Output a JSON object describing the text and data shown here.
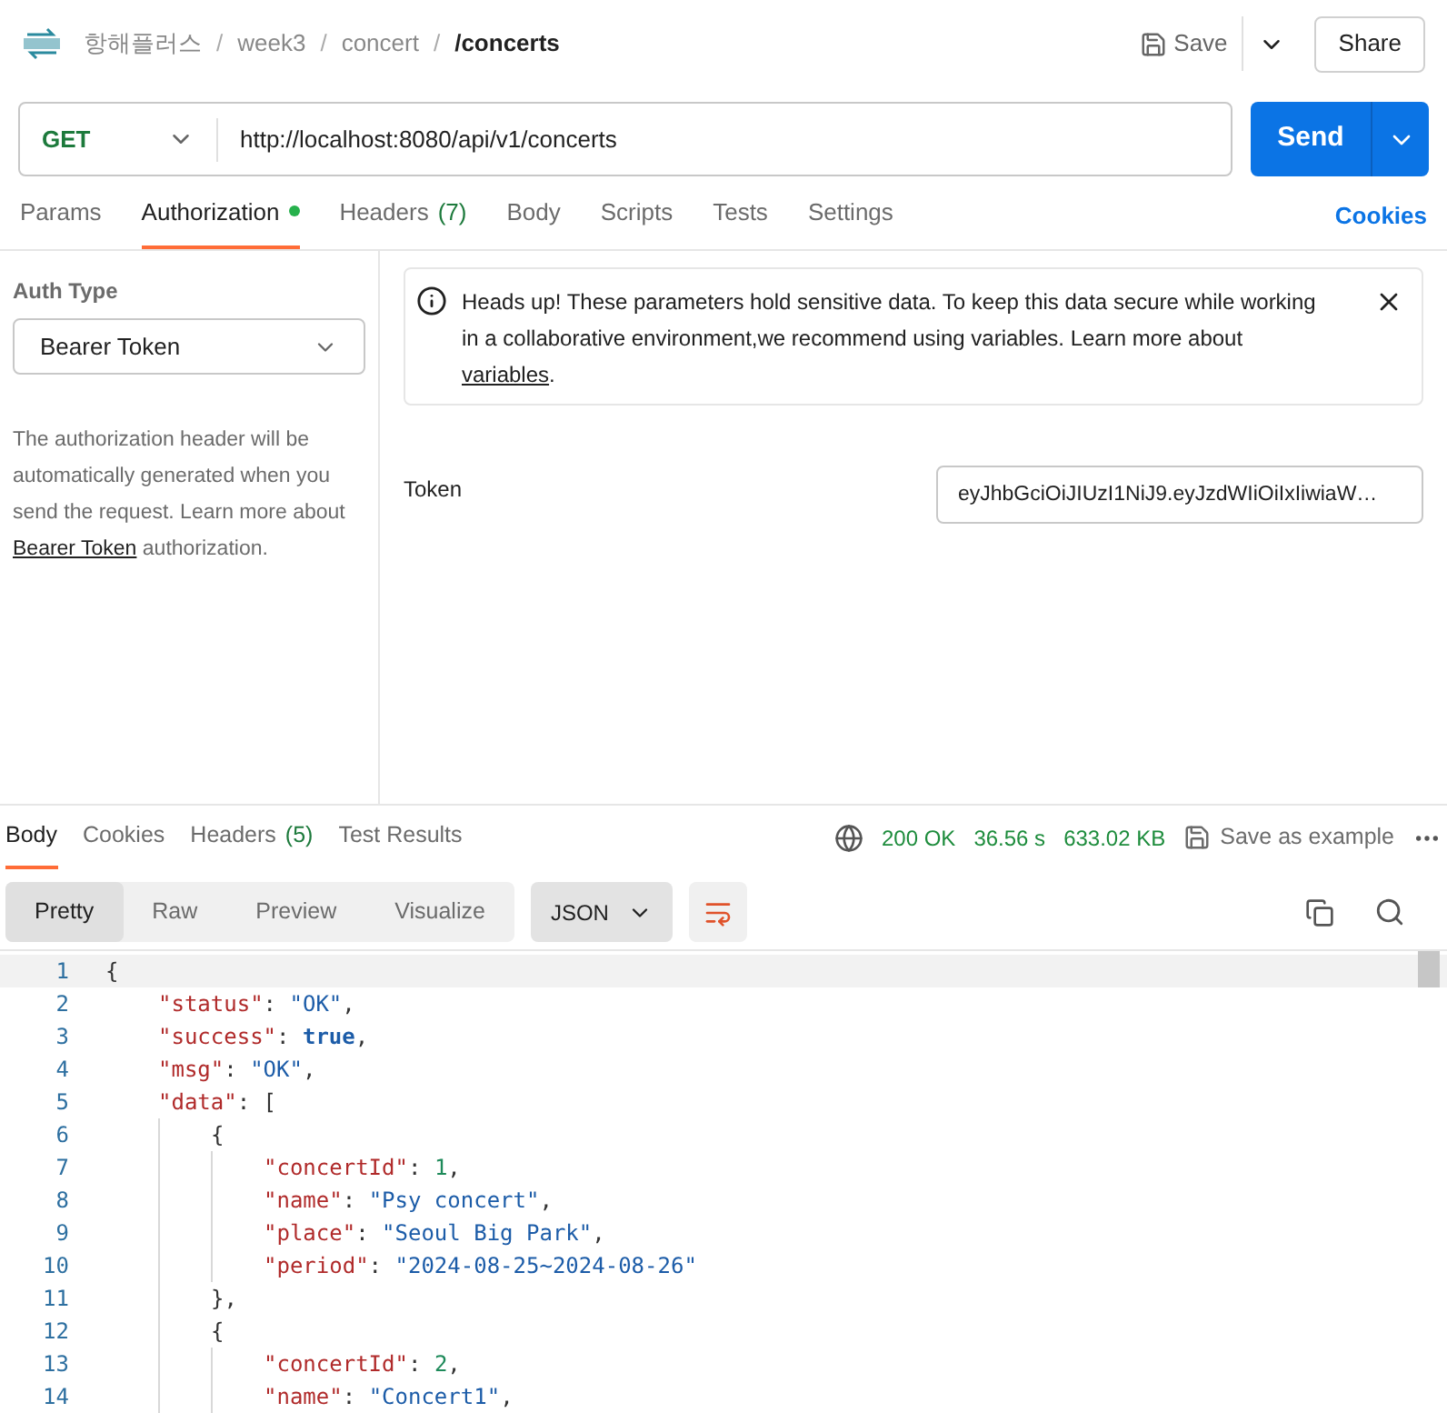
{
  "breadcrumb": [
    {
      "kind": "crumb",
      "text": "항해플러스"
    },
    {
      "kind": "separator",
      "text": "/"
    },
    {
      "kind": "crumb",
      "text": "week3"
    },
    {
      "kind": "separator",
      "text": "/"
    },
    {
      "kind": "crumb",
      "text": "concert"
    },
    {
      "kind": "separator",
      "text": "/"
    },
    {
      "kind": "current",
      "text": "/concerts"
    }
  ],
  "header_actions": {
    "save": "Save",
    "share": "Share"
  },
  "request": {
    "method": "GET",
    "url": "http://localhost:8080/api/v1/concerts",
    "send": "Send"
  },
  "request_tabs": [
    {
      "label": "Params",
      "selected": false
    },
    {
      "label": "Authorization",
      "selected": true,
      "dot": true
    },
    {
      "label": "Headers",
      "count": "(7)",
      "selected": false
    },
    {
      "label": "Body",
      "selected": false
    },
    {
      "label": "Scripts",
      "selected": false
    },
    {
      "label": "Tests",
      "selected": false
    },
    {
      "label": "Settings",
      "selected": false
    }
  ],
  "cookies_link": "Cookies",
  "auth": {
    "type_label": "Auth Type",
    "type": "Bearer Token",
    "description": "The authorization header will be automatically generated when you send the request. Learn more about ",
    "description_link": "Bearer Token",
    "description_end": " authorization.",
    "notice": "Heads up! These parameters hold sensitive data. To keep this data secure while working in a collaborative environment,we recommend using variables. Learn more about ",
    "notice_link": "variables",
    "notice_end": ".",
    "token_label": "Token",
    "token_value": "eyJhbGciOiJIUzI1NiJ9.eyJzdWIiOiIxIiwiaW…"
  },
  "response_tabs": [
    {
      "label": "Body",
      "selected": true
    },
    {
      "label": "Cookies",
      "selected": false
    },
    {
      "label": "Headers",
      "count": "(5)",
      "selected": false
    },
    {
      "label": "Test Results",
      "selected": false
    }
  ],
  "response_meta": {
    "status": "200 OK",
    "time": "36.56 s",
    "size": "633.02 KB",
    "save_example": "Save as example"
  },
  "view_modes": [
    {
      "label": "Pretty",
      "selected": true
    },
    {
      "label": "Raw",
      "selected": false
    },
    {
      "label": "Preview",
      "selected": false
    },
    {
      "label": "Visualize",
      "selected": false
    }
  ],
  "format": "JSON",
  "code_lines": [
    {
      "number": "1",
      "tokens": [
        {
          "kind": "punct",
          "text": "{"
        }
      ]
    },
    {
      "number": "2",
      "tokens": [
        {
          "kind": "key",
          "text": "\"status\""
        },
        {
          "kind": "punct",
          "text": ": "
        },
        {
          "kind": "string",
          "text": "\"OK\""
        },
        {
          "kind": "punct",
          "text": ","
        }
      ]
    },
    {
      "number": "3",
      "tokens": [
        {
          "kind": "key",
          "text": "\"success\""
        },
        {
          "kind": "punct",
          "text": ": "
        },
        {
          "kind": "bool",
          "text": "true"
        },
        {
          "kind": "punct",
          "text": ","
        }
      ]
    },
    {
      "number": "4",
      "tokens": [
        {
          "kind": "key",
          "text": "\"msg\""
        },
        {
          "kind": "punct",
          "text": ": "
        },
        {
          "kind": "string",
          "text": "\"OK\""
        },
        {
          "kind": "punct",
          "text": ","
        }
      ]
    },
    {
      "number": "5",
      "tokens": [
        {
          "kind": "key",
          "text": "\"data\""
        },
        {
          "kind": "punct",
          "text": ": ["
        }
      ]
    },
    {
      "number": "6",
      "tokens": [
        {
          "kind": "punct",
          "text": "{"
        }
      ]
    },
    {
      "number": "7",
      "tokens": [
        {
          "kind": "key",
          "text": "\"concertId\""
        },
        {
          "kind": "punct",
          "text": ": "
        },
        {
          "kind": "number",
          "text": "1"
        },
        {
          "kind": "punct",
          "text": ","
        }
      ]
    },
    {
      "number": "8",
      "tokens": [
        {
          "kind": "key",
          "text": "\"name\""
        },
        {
          "kind": "punct",
          "text": ": "
        },
        {
          "kind": "string",
          "text": "\"Psy concert\""
        },
        {
          "kind": "punct",
          "text": ","
        }
      ]
    },
    {
      "number": "9",
      "tokens": [
        {
          "kind": "key",
          "text": "\"place\""
        },
        {
          "kind": "punct",
          "text": ": "
        },
        {
          "kind": "string",
          "text": "\"Seoul Big Park\""
        },
        {
          "kind": "punct",
          "text": ","
        }
      ]
    },
    {
      "number": "10",
      "tokens": [
        {
          "kind": "key",
          "text": "\"period\""
        },
        {
          "kind": "punct",
          "text": ": "
        },
        {
          "kind": "string",
          "text": "\"2024-08-25~2024-08-26\""
        }
      ]
    },
    {
      "number": "11",
      "tokens": [
        {
          "kind": "punct",
          "text": "},"
        }
      ]
    },
    {
      "number": "12",
      "tokens": [
        {
          "kind": "punct",
          "text": "{"
        }
      ]
    },
    {
      "number": "13",
      "tokens": [
        {
          "kind": "key",
          "text": "\"concertId\""
        },
        {
          "kind": "punct",
          "text": ": "
        },
        {
          "kind": "number",
          "text": "2"
        },
        {
          "kind": "punct",
          "text": ","
        }
      ]
    },
    {
      "number": "14",
      "tokens": [
        {
          "kind": "key",
          "text": "\"name\""
        },
        {
          "kind": "punct",
          "text": ": "
        },
        {
          "kind": "string",
          "text": "\"Concert1\""
        },
        {
          "kind": "punct",
          "text": ","
        }
      ]
    }
  ]
}
